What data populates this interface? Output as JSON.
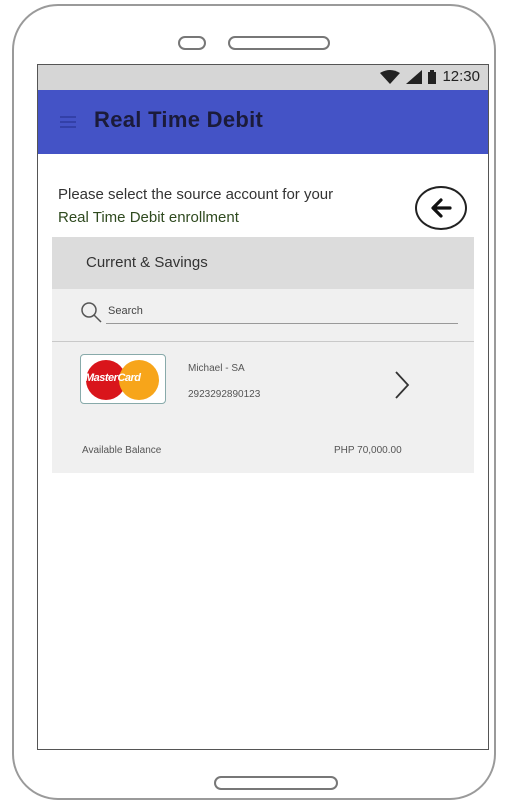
{
  "status_bar": {
    "time": "12:30"
  },
  "app_bar": {
    "title": "Real Time Debit"
  },
  "prompt": {
    "line1": "Please select the source account for your",
    "line2": "Real Time Debit enrollment"
  },
  "section": {
    "title": "Current & Savings"
  },
  "search": {
    "placeholder": "Search"
  },
  "account": {
    "card_brand": "MasterCard",
    "name": "Michael - SA",
    "number": "2923292890123",
    "balance_label": "Available Balance",
    "balance_value": "PHP 70,000.00"
  },
  "colors": {
    "app_bar": "#4453c6",
    "status_bar": "#d6d6d6",
    "section_header": "#dcdcdc",
    "card_bg": "#f0f0f0",
    "mastercard_red": "#d9151b",
    "mastercard_yellow": "#f7a51a"
  },
  "icons": [
    "wifi-icon",
    "signal-icon",
    "battery-icon",
    "menu-icon",
    "back-arrow-icon",
    "search-icon",
    "chevron-right-icon"
  ]
}
